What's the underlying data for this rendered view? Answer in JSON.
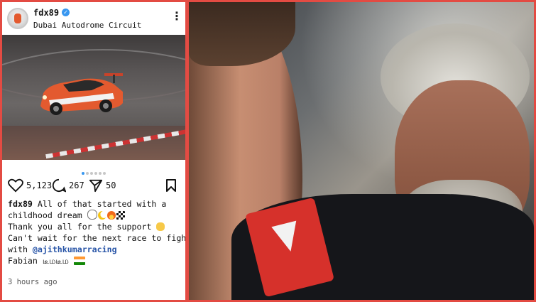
{
  "post": {
    "username": "fdx89",
    "verified_icon": "check",
    "location": "Dubai Autodrome Circuit",
    "more_icon": "⋮",
    "likes": "5,123",
    "comments": "267",
    "shares": "50",
    "caption": {
      "line1_user": "fdx89",
      "line1_text": " All of that started with a",
      "line2_text": "childhood dream",
      "line3_text": "Thank you all for the support",
      "line4_text": "Can't wait for the next race to fight",
      "line5_prefix": "with ",
      "line5_mention": "@ajithkumarracing",
      "line6_text": "Fabian ",
      "line6_tamil": "டீமடீம"
    },
    "timestamp": "3 hours ago",
    "carousel_dots": 6,
    "active_dot": 0
  },
  "colors": {
    "frame": "#e34b43",
    "verified": "#3897f0",
    "mention": "#2a56a8",
    "car_orange": "#e35a2f"
  }
}
